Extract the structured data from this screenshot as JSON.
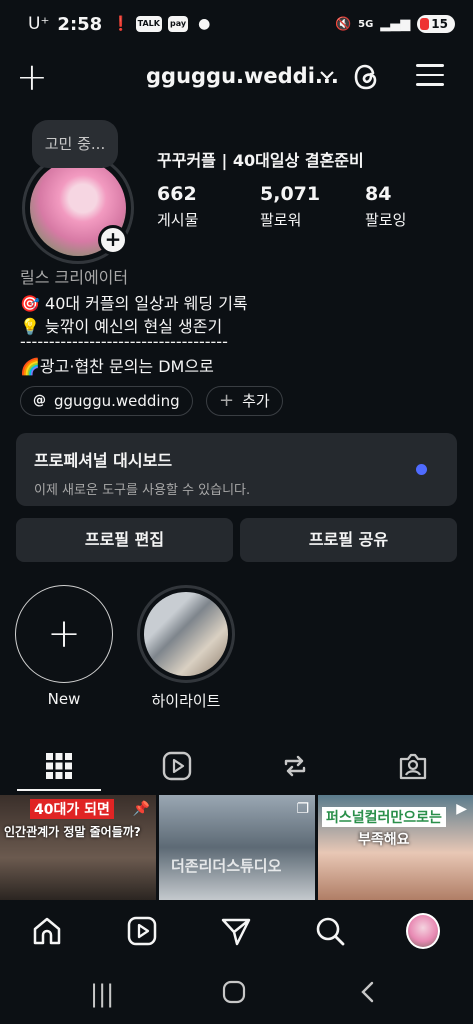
{
  "status_bar": {
    "carrier": "U⁺",
    "time": "2:58",
    "notif_talk": "TALK",
    "notif_pay": "pay",
    "network": "5G",
    "battery": "15"
  },
  "header": {
    "username": "gguggu.weddi...",
    "icons": [
      "plus-icon",
      "chevron-down-icon",
      "threads-icon",
      "menu-icon"
    ]
  },
  "profile": {
    "note": "고민 중...",
    "display_name": "꾸꾸커플 | 40대일상 결혼준비",
    "stats": [
      {
        "value": "662",
        "label": "게시물"
      },
      {
        "value": "5,071",
        "label": "팔로워"
      },
      {
        "value": "84",
        "label": "팔로잉"
      }
    ],
    "category": "릴스 크리에이터",
    "bio": [
      "🎯 40대 커플의 일상과 웨딩 기록",
      "💡 늦깎이 예신의 현실 생존기",
      "------------------------------------",
      "🌈광고·협찬 문의는 DM으로"
    ],
    "threads_chip": "gguggu.wedding",
    "add_chip": "추가"
  },
  "dashboard": {
    "title": "프로페셔널 대시보드",
    "subtitle": "이제 새로운 도구를 사용할 수 있습니다."
  },
  "actions": {
    "edit": "프로필 편집",
    "share": "프로필 공유"
  },
  "highlights": [
    {
      "label": "New"
    },
    {
      "label": "하이라이트"
    }
  ],
  "grid": [
    {
      "caption_top": "40대가 되면",
      "caption_bottom": "인간관계가 정말 줄어들까?"
    },
    {
      "caption": "더존리더스튜디오"
    },
    {
      "caption_top": "퍼스널컬러만으로는",
      "caption_bottom": "부족해요"
    }
  ],
  "colors": {
    "background": "#0c1014",
    "card": "#25292e",
    "accent_dot": "#4f6bff"
  }
}
